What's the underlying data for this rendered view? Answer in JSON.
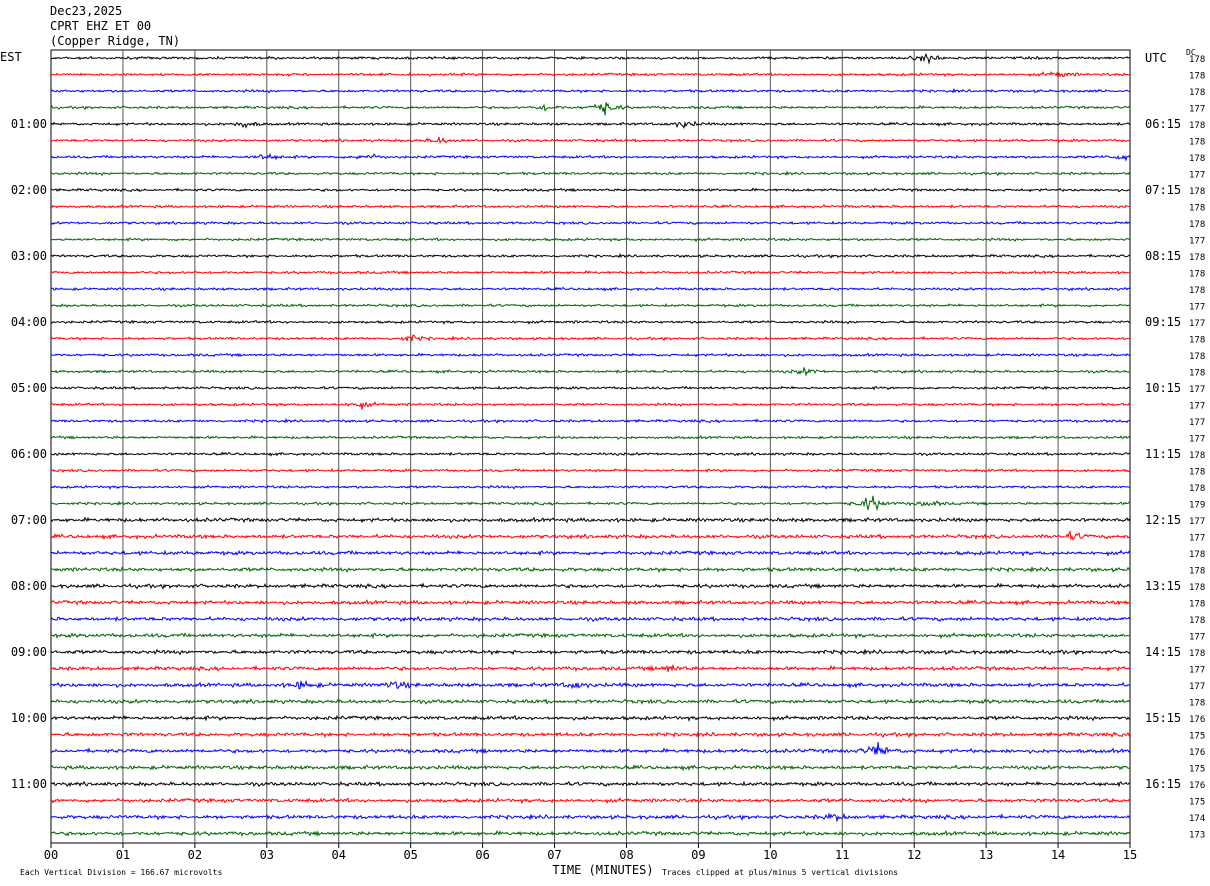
{
  "header": {
    "date": "Dec23,2025",
    "station": "CPRT EHZ ET 00",
    "location": "(Copper Ridge, TN)"
  },
  "chart_data": {
    "type": "line",
    "left_tz": "EST",
    "right_tz": "UTC",
    "dc_label": "DC",
    "xlabel": "TIME (MINUTES)",
    "x_ticks": [
      "00",
      "01",
      "02",
      "03",
      "04",
      "05",
      "06",
      "07",
      "08",
      "09",
      "10",
      "11",
      "12",
      "13",
      "14",
      "15"
    ],
    "xlim": [
      0,
      15
    ],
    "traces_per_hour": 4,
    "trace_colors": [
      "#000000",
      "#ff0000",
      "#0000ff",
      "#006400"
    ],
    "left_hour_labels": [
      "",
      "01:00",
      "02:00",
      "03:00",
      "04:00",
      "05:00",
      "06:00",
      "07:00",
      "08:00",
      "09:00",
      "10:00",
      "11:00"
    ],
    "right_hour_labels": [
      "UTC",
      "06:15",
      "07:15",
      "08:15",
      "09:15",
      "10:15",
      "11:15",
      "12:15",
      "13:15",
      "14:15",
      "15:15",
      "16:15"
    ],
    "dc_offsets": [
      178,
      178,
      178,
      177,
      178,
      178,
      178,
      177,
      178,
      178,
      178,
      177,
      178,
      178,
      178,
      177,
      177,
      178,
      178,
      178,
      177,
      177,
      177,
      177,
      178,
      178,
      178,
      179,
      177,
      177,
      178,
      178,
      178,
      178,
      178,
      177,
      178,
      177,
      177,
      178,
      176,
      175,
      176,
      175,
      176,
      175,
      174,
      173
    ],
    "events": [
      {
        "trace": 0,
        "minute": 12.2,
        "amp": 4
      },
      {
        "trace": 1,
        "minute": 14.0,
        "amp": 3
      },
      {
        "trace": 3,
        "minute": 7.7,
        "amp": 7
      },
      {
        "trace": 3,
        "minute": 6.9,
        "amp": 3
      },
      {
        "trace": 4,
        "minute": 2.7,
        "amp": 3
      },
      {
        "trace": 4,
        "minute": 8.8,
        "amp": 3
      },
      {
        "trace": 5,
        "minute": 5.4,
        "amp": 3
      },
      {
        "trace": 6,
        "minute": 3.0,
        "amp": 3
      },
      {
        "trace": 6,
        "minute": 4.4,
        "amp": 3
      },
      {
        "trace": 6,
        "minute": 14.9,
        "amp": 3
      },
      {
        "trace": 17,
        "minute": 5.0,
        "amp": 3
      },
      {
        "trace": 19,
        "minute": 10.5,
        "amp": 3
      },
      {
        "trace": 21,
        "minute": 4.3,
        "amp": 3
      },
      {
        "trace": 27,
        "minute": 11.4,
        "amp": 8
      },
      {
        "trace": 27,
        "minute": 12.2,
        "amp": 3
      },
      {
        "trace": 29,
        "minute": 14.2,
        "amp": 3
      },
      {
        "trace": 37,
        "minute": 8.6,
        "amp": 3
      },
      {
        "trace": 38,
        "minute": 3.5,
        "amp": 4
      },
      {
        "trace": 38,
        "minute": 4.8,
        "amp": 3
      },
      {
        "trace": 38,
        "minute": 7.3,
        "amp": 3
      },
      {
        "trace": 42,
        "minute": 11.5,
        "amp": 7
      },
      {
        "trace": 46,
        "minute": 10.9,
        "amp": 3
      }
    ]
  },
  "footer": {
    "scale_note": "Each Vertical Division = 166.67 microvolts",
    "clip_note": "Traces clipped at plus/minus 5 vertical divisions"
  }
}
